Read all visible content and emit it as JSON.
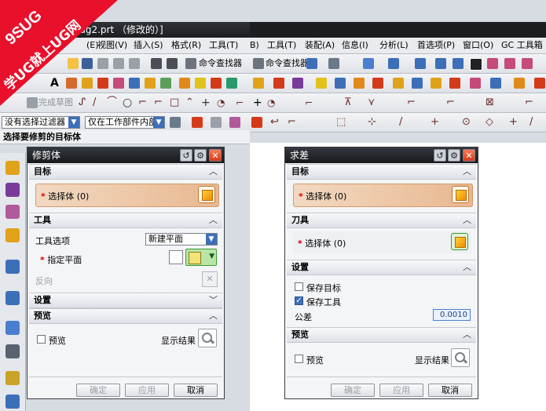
{
  "watermark": {
    "line1": "9SUG",
    "line2": "学UG就上UG网"
  },
  "left_app": {
    "title": "sug2.prt （修改的）]",
    "menu": [
      "(E)",
      "视图(V)",
      "插入(S)",
      "格式(R)",
      "工具(T)"
    ],
    "command_finder_label": "命令查找器",
    "sketch_label": "完成草图",
    "filter_label": "没有选择过滤器",
    "scope_label": "仅在工作部件内部",
    "status": "选择要修剪的目标体"
  },
  "right_app": {
    "menu": [
      "B)",
      "工具(T)",
      "装配(A)",
      "信息(I)",
      "分析(L)",
      "首选项(P)",
      "窗口(O)",
      "GC 工具箱"
    ],
    "command_finder_label": "命令查找器"
  },
  "trim_dialog": {
    "title": "修剪体",
    "target_section": "目标",
    "target_select": "选择体 (0)",
    "tool_section": "工具",
    "tool_option_label": "工具选项",
    "tool_option_value": "新建平面",
    "specify_plane": "指定平面",
    "reverse": "反向",
    "settings_section": "设置",
    "preview_section": "预览",
    "preview_label": "预览",
    "show_result": "显示结果",
    "ok": "确定",
    "apply": "应用",
    "cancel": "取消"
  },
  "subtract_dialog": {
    "title": "求差",
    "target_section": "目标",
    "target_select": "选择体 (0)",
    "tool_section": "刀具",
    "tool_select": "选择体 (0)",
    "settings_section": "设置",
    "keep_target": "保存目标",
    "keep_tool": "保存工具",
    "tolerance_label": "公差",
    "tolerance_value": "0.0010",
    "preview_section": "预览",
    "preview_label": "预览",
    "show_result": "显示结果",
    "ok": "确定",
    "apply": "应用",
    "cancel": "取消"
  },
  "colors": {
    "accent": "#3d6fb9",
    "watermark": "#e8102a",
    "titlebar": "#1b1d20"
  }
}
